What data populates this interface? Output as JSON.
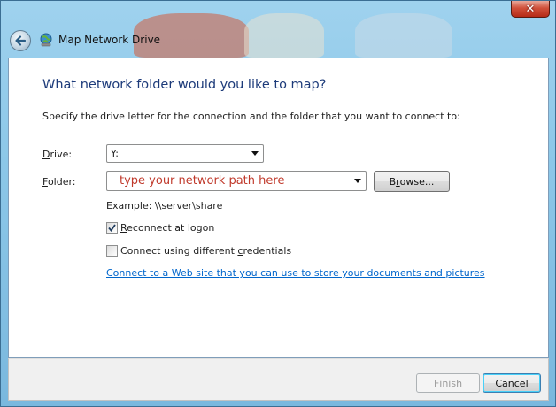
{
  "window": {
    "title": "Map Network Drive",
    "close_glyph": "✕",
    "back_icon": "back-arrow-icon",
    "title_icon": "network-drive-icon"
  },
  "main": {
    "heading": "What network folder would you like to map?",
    "instructions": "Specify the drive letter for the connection and the folder that you want to connect to:",
    "drive": {
      "label_pre": "",
      "label_ul": "D",
      "label_post": "rive:",
      "value": "Y:"
    },
    "folder": {
      "label_pre": "",
      "label_ul": "F",
      "label_post": "older:",
      "value": "type your network path here",
      "value_color": "#c0392b",
      "browse_pre": "B",
      "browse_ul": "r",
      "browse_post": "owse..."
    },
    "example": "Example: \\\\server\\share",
    "reconnect": {
      "checked": true,
      "pre": "",
      "ul": "R",
      "post": "econnect at logon"
    },
    "credentials": {
      "checked": false,
      "pre": "Connect using different ",
      "ul": "c",
      "post": "redentials"
    },
    "link": "Connect to a Web site that you can use to store your documents and pictures",
    "link_suffix": "."
  },
  "footer": {
    "finish_pre": "",
    "finish_ul": "F",
    "finish_post": "inish",
    "finish_disabled": true,
    "cancel": "Cancel"
  },
  "colors": {
    "heading": "#1d3b7a",
    "link": "#0066cc",
    "accent": "#3c7fb1"
  }
}
